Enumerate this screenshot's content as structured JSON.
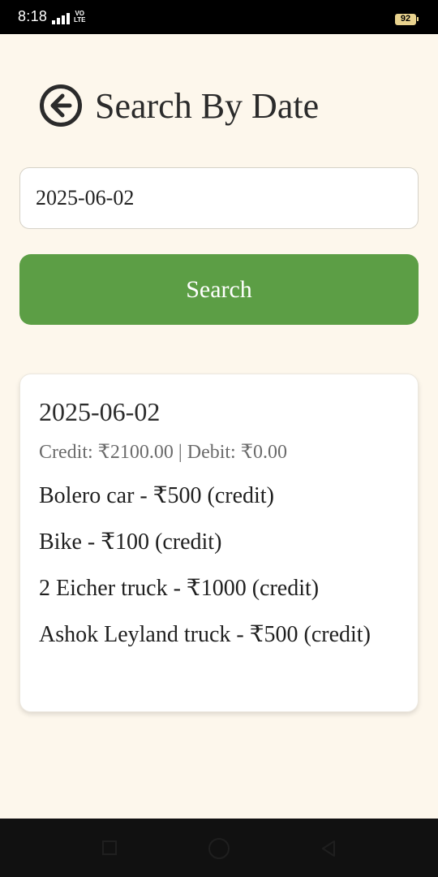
{
  "status_bar": {
    "time": "8:18",
    "network_label_top": "VO",
    "network_label_bottom": "LTE",
    "battery": "92"
  },
  "header": {
    "back_icon": "arrow-left-circle-icon",
    "title": "Search By Date"
  },
  "search": {
    "date_value": "2025-06-02",
    "button_label": "Search"
  },
  "result": {
    "date": "2025-06-02",
    "summary": "Credit: ₹2100.00 | Debit: ₹0.00",
    "entries": [
      "Bolero car - ₹500 (credit)",
      "Bike - ₹100 (credit)",
      "2 Eicher truck - ₹1000 (credit)",
      "Ashok Leyland truck - ₹500 (credit)"
    ]
  },
  "nav_bar": {
    "icons": [
      "recent-apps-icon",
      "home-icon",
      "back-icon"
    ]
  },
  "colors": {
    "background": "#fdf7ec",
    "button": "#5c9e45",
    "title_text": "#2b2b2b"
  }
}
